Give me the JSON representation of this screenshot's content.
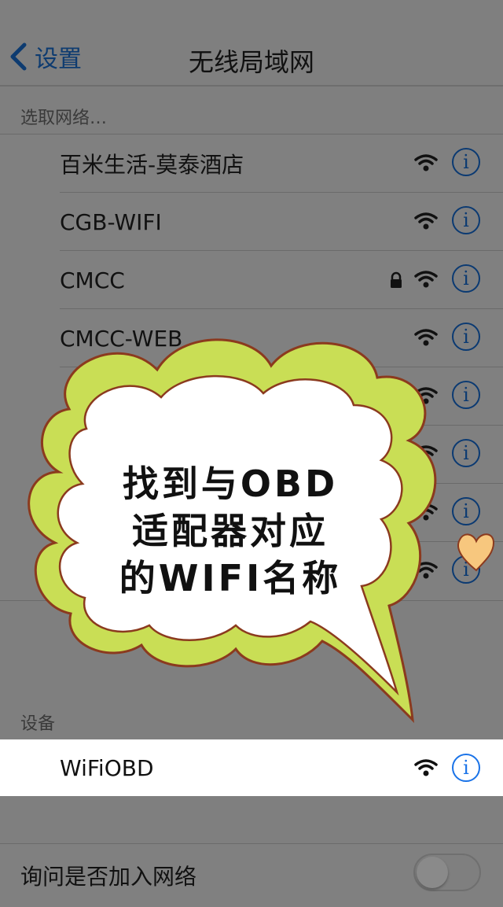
{
  "navbar": {
    "back_label": "设置",
    "title": "无线局域网"
  },
  "networks_header": "选取网络…",
  "networks": [
    {
      "name": "百米生活-莫泰酒店",
      "locked": false
    },
    {
      "name": "CGB-WIFI",
      "locked": false
    },
    {
      "name": "CMCC",
      "locked": true
    },
    {
      "name": "CMCC-WEB",
      "locked": false
    },
    {
      "name": "",
      "locked": true
    },
    {
      "name": "",
      "locked": false
    },
    {
      "name": "",
      "locked": false
    },
    {
      "name": "",
      "locked": false
    }
  ],
  "devices_header": "设备",
  "device": {
    "name": "WiFiOBD"
  },
  "ask_join_label": "询问是否加入网络",
  "ask_join_enabled": false,
  "callout": {
    "lines": [
      "找到与OBD",
      "适配器对应",
      "的WIFI名称"
    ]
  },
  "colors": {
    "accent": "#1a73e8",
    "dim_overlay": "#7f7f7f",
    "bubble_green": "#c9de55",
    "bubble_outline": "#8b3a1e",
    "heart": "#f7c77e"
  },
  "icons": [
    "chevron-left-icon",
    "wifi-icon",
    "lock-icon",
    "info-icon",
    "heart-icon"
  ]
}
